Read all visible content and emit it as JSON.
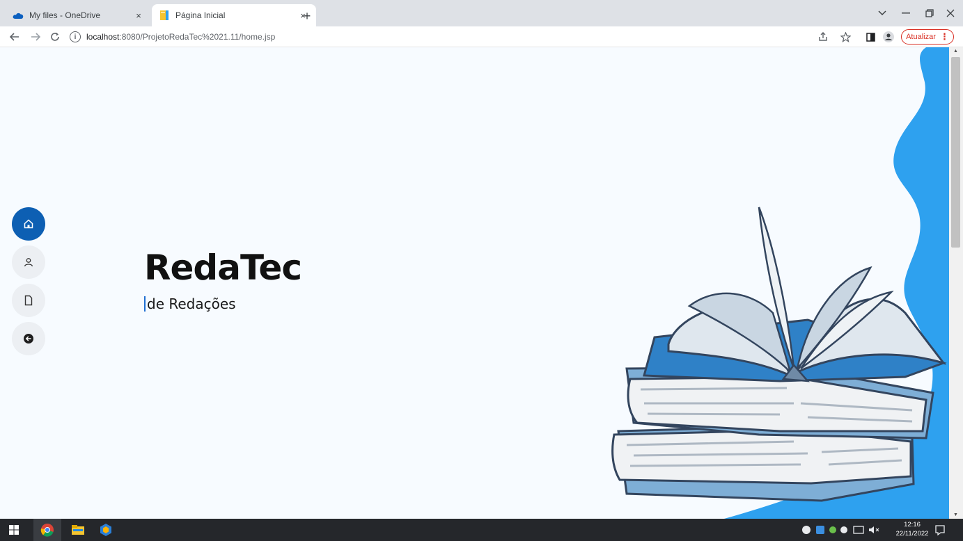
{
  "browser": {
    "tabs": [
      {
        "title": "My files - OneDrive",
        "favicon": "onedrive-icon",
        "active": false
      },
      {
        "title": "Página Inicial",
        "favicon": "page-favicon",
        "active": true
      }
    ],
    "url_host": "localhost",
    "url_path": ":8080/ProjetoRedaTec%2021.11/home.jsp",
    "update_label": "Atualizar",
    "new_tab_symbol": "+",
    "close_symbol": "×"
  },
  "page": {
    "title": "RedaTec",
    "subtitle": "de Redações",
    "menu": [
      {
        "icon": "home-icon",
        "active": true
      },
      {
        "icon": "user-icon",
        "active": false
      },
      {
        "icon": "file-icon",
        "active": false
      },
      {
        "icon": "back-arrow-icon",
        "active": false
      }
    ],
    "colors": {
      "accent": "#0d5fb3",
      "wave": "#2ea1ef",
      "background": "#f7fbff"
    }
  },
  "taskbar": {
    "time": "12:16",
    "date": "22/11/2022"
  }
}
